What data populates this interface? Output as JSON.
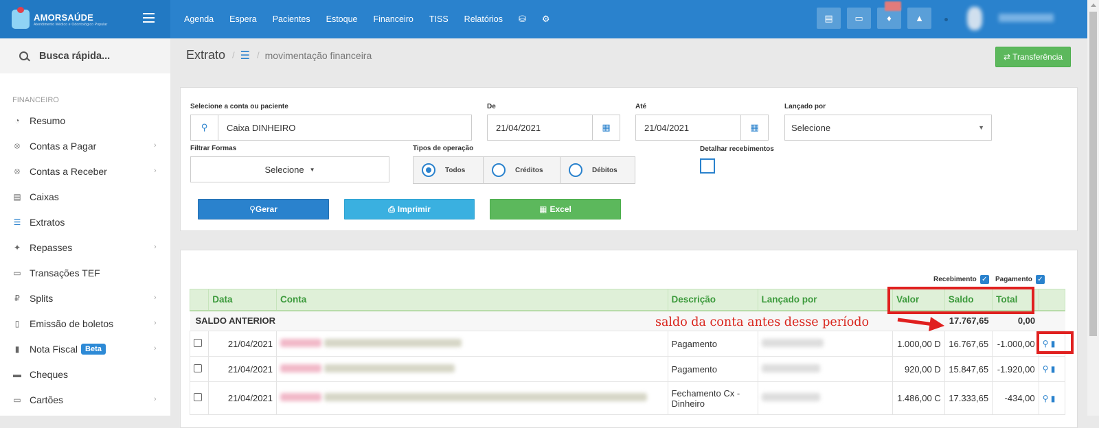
{
  "brand": {
    "name": "AMORSAÚDE",
    "tagline": "Atendimento Médico e Odontológico Popular"
  },
  "topnav": [
    "Agenda",
    "Espera",
    "Pacientes",
    "Estoque",
    "Financeiro",
    "TISS",
    "Relatórios"
  ],
  "topnav_icons": [
    "database-icon",
    "gear-icon"
  ],
  "top_buttons": [
    "inbox-icon",
    "card-icon",
    "bell-icon",
    "chat-icon"
  ],
  "sidebar": {
    "search_placeholder": "Busca rápida...",
    "section": "FINANCEIRO",
    "items": [
      {
        "label": "Resumo",
        "icon": "pie-icon",
        "chevron": false
      },
      {
        "label": "Contas a Pagar",
        "icon": "arrow-up-circle-icon",
        "chevron": true
      },
      {
        "label": "Contas a Receber",
        "icon": "arrow-down-circle-icon",
        "chevron": true
      },
      {
        "label": "Caixas",
        "icon": "inbox-icon",
        "chevron": false
      },
      {
        "label": "Extratos",
        "icon": "list-icon",
        "chevron": false
      },
      {
        "label": "Repasses",
        "icon": "puzzle-icon",
        "chevron": true
      },
      {
        "label": "Transações TEF",
        "icon": "credit-card-icon",
        "chevron": false
      },
      {
        "label": "Splits",
        "icon": "ruble-icon",
        "chevron": true
      },
      {
        "label": "Emissão de boletos",
        "icon": "barcode-icon",
        "chevron": true
      },
      {
        "label": "Nota Fiscal",
        "icon": "file-icon",
        "chevron": true,
        "badge": "Beta"
      },
      {
        "label": "Cheques",
        "icon": "money-icon",
        "chevron": false
      },
      {
        "label": "Cartões",
        "icon": "credit-card-icon",
        "chevron": true
      }
    ]
  },
  "header": {
    "title": "Extrato",
    "breadcrumb": "movimentação financeira",
    "transfer_label": "⇄ Transferência"
  },
  "filters": {
    "account_label": "Selecione a conta ou paciente",
    "account_value": "Caixa DINHEIRO",
    "from_label": "De",
    "from_value": "21/04/2021",
    "to_label": "Até",
    "to_value": "21/04/2021",
    "posted_by_label": "Lançado por",
    "posted_by_value": "Selecione",
    "forms_label": "Filtrar Formas",
    "forms_value": "Selecione",
    "op_types_label": "Tipos de operação",
    "op_types": [
      "Todos",
      "Créditos",
      "Débitos"
    ],
    "op_selected": "Todos",
    "detail_label": "Detalhar recebimentos"
  },
  "actions": {
    "generate": "Gerar",
    "print": "Imprimir",
    "excel": "Excel"
  },
  "legend": {
    "receipt": "Recebimento",
    "payment": "Pagamento"
  },
  "table": {
    "columns": [
      "Data",
      "Conta",
      "Descrição",
      "Lançado por",
      "Valor",
      "Saldo",
      "Total"
    ],
    "previous_balance_label": "SALDO ANTERIOR",
    "previous_balance": "17.767,65",
    "previous_total": "0,00",
    "rows": [
      {
        "date": "21/04/2021",
        "description": "Pagamento",
        "value": "1.000,00 D",
        "balance": "16.767,65",
        "total": "-1.000,00"
      },
      {
        "date": "21/04/2021",
        "description": "Pagamento",
        "value": "920,00 D",
        "balance": "15.847,65",
        "total": "-1.920,00"
      },
      {
        "date": "21/04/2021",
        "description": "Fechamento Cx - Dinheiro",
        "value": "1.486,00 C",
        "balance": "17.333,65",
        "total": "-434,00"
      }
    ]
  },
  "annotation": "saldo da conta antes desse período",
  "colors": {
    "topbar": "#2a82cd",
    "green": "#5cb85c",
    "annotation_red": "#e0201f"
  }
}
